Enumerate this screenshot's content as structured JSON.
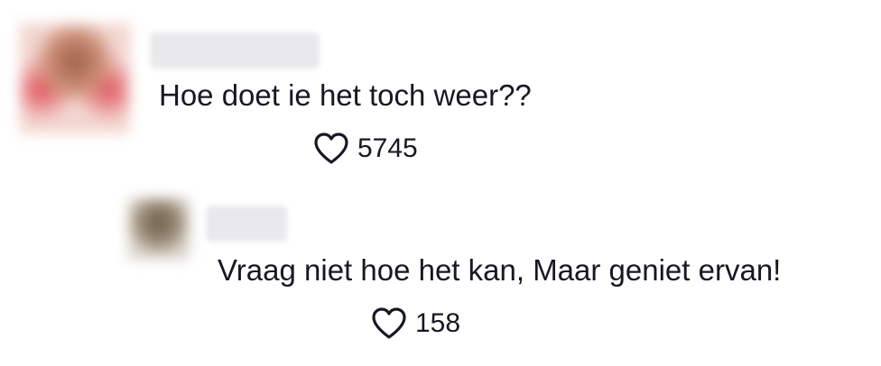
{
  "comments": [
    {
      "text": "Hoe doet ie het toch weer??",
      "likes": "5745"
    },
    {
      "text": "Vraag niet hoe het kan, Maar geniet ervan!",
      "likes": "158"
    }
  ],
  "icons": {
    "like": "heart-outline-icon"
  },
  "colors": {
    "text": "#161823",
    "username_placeholder": "#e9e9ec"
  }
}
